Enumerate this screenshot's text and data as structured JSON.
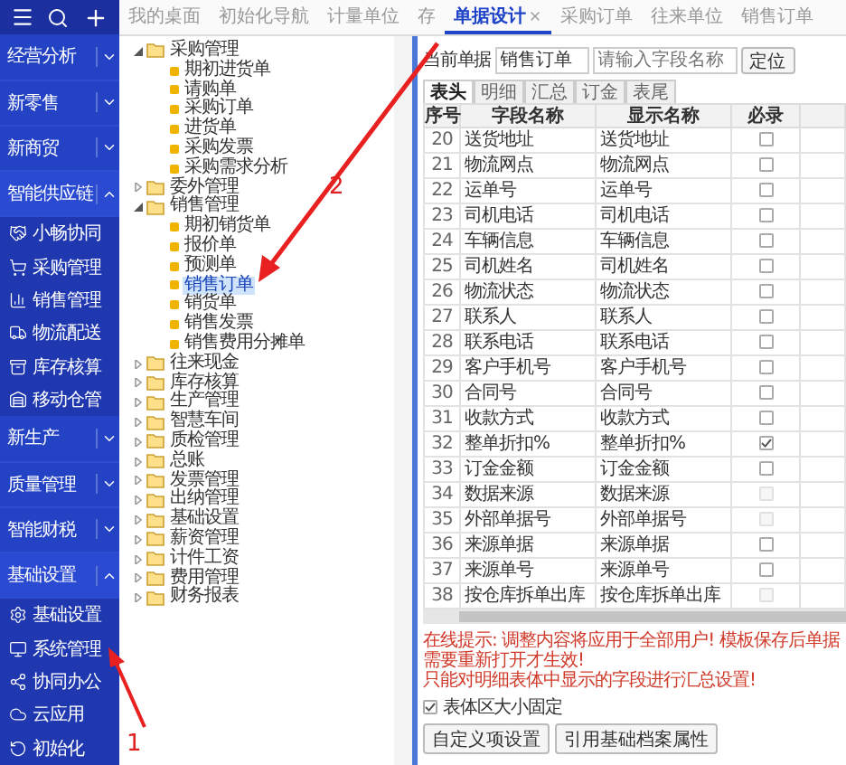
{
  "sidebar": {
    "groups": [
      {
        "label": "经营分析",
        "expanded": false
      },
      {
        "label": "新零售",
        "expanded": false
      },
      {
        "label": "新商贸",
        "expanded": false
      },
      {
        "label": "智能供应链",
        "expanded": true,
        "children": [
          {
            "label": "小畅协同"
          },
          {
            "label": "采购管理"
          },
          {
            "label": "销售管理"
          },
          {
            "label": "物流配送"
          },
          {
            "label": "库存核算"
          },
          {
            "label": "移动仓管"
          }
        ]
      },
      {
        "label": "新生产",
        "expanded": false
      },
      {
        "label": "质量管理",
        "expanded": false
      },
      {
        "label": "智能财税",
        "expanded": false
      },
      {
        "label": "基础设置",
        "expanded": true,
        "children": [
          {
            "label": "基础设置"
          },
          {
            "label": "系统管理"
          },
          {
            "label": "协同办公"
          },
          {
            "label": "云应用"
          },
          {
            "label": "初始化"
          }
        ]
      }
    ]
  },
  "tabs": [
    {
      "label": "我的桌面",
      "selected": false,
      "closable": false
    },
    {
      "label": "初始化导航",
      "selected": false,
      "closable": false
    },
    {
      "label": "计量单位",
      "selected": false,
      "closable": false
    },
    {
      "label": "存",
      "selected": false,
      "closable": false
    },
    {
      "label": "单据设计",
      "selected": true,
      "closable": true
    },
    {
      "label": "采购订单",
      "selected": false,
      "closable": false
    },
    {
      "label": "往来单位",
      "selected": false,
      "closable": false
    },
    {
      "label": "销售订单",
      "selected": false,
      "closable": false
    }
  ],
  "tree": [
    {
      "label": "采购管理",
      "expanded": true,
      "selected": false,
      "children": [
        {
          "label": "期初进货单",
          "selected": false
        },
        {
          "label": "请购单",
          "selected": false
        },
        {
          "label": "采购订单",
          "selected": false
        },
        {
          "label": "进货单",
          "selected": false
        },
        {
          "label": "采购发票",
          "selected": false
        },
        {
          "label": "采购需求分析",
          "selected": false
        }
      ]
    },
    {
      "label": "委外管理",
      "expanded": false,
      "selected": false
    },
    {
      "label": "销售管理",
      "expanded": true,
      "selected": false,
      "children": [
        {
          "label": "期初销货单",
          "selected": false
        },
        {
          "label": "报价单",
          "selected": false
        },
        {
          "label": "预测单",
          "selected": false
        },
        {
          "label": "销售订单",
          "selected": true
        },
        {
          "label": "销货单",
          "selected": false
        },
        {
          "label": "销售发票",
          "selected": false
        },
        {
          "label": "销售费用分摊单",
          "selected": false
        }
      ]
    },
    {
      "label": "往来现金",
      "expanded": false,
      "selected": false
    },
    {
      "label": "库存核算",
      "expanded": false,
      "selected": false
    },
    {
      "label": "生产管理",
      "expanded": false,
      "selected": false
    },
    {
      "label": "智慧车间",
      "expanded": false,
      "selected": false
    },
    {
      "label": "质检管理",
      "expanded": false,
      "selected": false
    },
    {
      "label": "总账",
      "expanded": false,
      "selected": false
    },
    {
      "label": "发票管理",
      "expanded": false,
      "selected": false
    },
    {
      "label": "出纳管理",
      "expanded": false,
      "selected": false
    },
    {
      "label": "基础设置",
      "expanded": false,
      "selected": false
    },
    {
      "label": "薪资管理",
      "expanded": false,
      "selected": false
    },
    {
      "label": "计件工资",
      "expanded": false,
      "selected": false
    },
    {
      "label": "费用管理",
      "expanded": false,
      "selected": false
    },
    {
      "label": "财务报表",
      "expanded": false,
      "selected": false
    }
  ],
  "designer": {
    "bill_label": "当前单据",
    "bill_value": "销售订单",
    "search": {
      "placeholder": "请输入字段名称"
    },
    "locate_button": "定位",
    "subtabs": [
      {
        "label": "表头",
        "selected": true
      },
      {
        "label": "明细",
        "selected": false
      },
      {
        "label": "汇总",
        "selected": false
      },
      {
        "label": "订金",
        "selected": false
      },
      {
        "label": "表尾",
        "selected": false
      }
    ],
    "table": {
      "columns": [
        "序号",
        "字段名称",
        "显示名称",
        "必录"
      ],
      "rows": [
        {
          "no": "20",
          "field": "送货地址",
          "display": "送货地址",
          "required": false,
          "disabled": false
        },
        {
          "no": "21",
          "field": "物流网点",
          "display": "物流网点",
          "required": false,
          "disabled": false
        },
        {
          "no": "22",
          "field": "运单号",
          "display": "运单号",
          "required": false,
          "disabled": false
        },
        {
          "no": "23",
          "field": "司机电话",
          "display": "司机电话",
          "required": false,
          "disabled": false
        },
        {
          "no": "24",
          "field": "车辆信息",
          "display": "车辆信息",
          "required": false,
          "disabled": false
        },
        {
          "no": "25",
          "field": "司机姓名",
          "display": "司机姓名",
          "required": false,
          "disabled": false
        },
        {
          "no": "26",
          "field": "物流状态",
          "display": "物流状态",
          "required": false,
          "disabled": false
        },
        {
          "no": "27",
          "field": "联系人",
          "display": "联系人",
          "required": false,
          "disabled": false
        },
        {
          "no": "28",
          "field": "联系电话",
          "display": "联系电话",
          "required": false,
          "disabled": false
        },
        {
          "no": "29",
          "field": "客户手机号",
          "display": "客户手机号",
          "required": false,
          "disabled": false
        },
        {
          "no": "30",
          "field": "合同号",
          "display": "合同号",
          "required": false,
          "disabled": false
        },
        {
          "no": "31",
          "field": "收款方式",
          "display": "收款方式",
          "required": false,
          "disabled": false
        },
        {
          "no": "32",
          "field": "整单折扣%",
          "display": "整单折扣%",
          "required": true,
          "disabled": false
        },
        {
          "no": "33",
          "field": "订金金额",
          "display": "订金金额",
          "required": false,
          "disabled": false
        },
        {
          "no": "34",
          "field": "数据来源",
          "display": "数据来源",
          "required": false,
          "disabled": true
        },
        {
          "no": "35",
          "field": "外部单据号",
          "display": "外部单据号",
          "required": false,
          "disabled": true
        },
        {
          "no": "36",
          "field": "来源单据",
          "display": "来源单据",
          "required": false,
          "disabled": false
        },
        {
          "no": "37",
          "field": "来源单号",
          "display": "来源单号",
          "required": false,
          "disabled": false
        },
        {
          "no": "38",
          "field": "按仓库拆单出库",
          "display": "按仓库拆单出库",
          "required": false,
          "disabled": true
        }
      ]
    },
    "hint_label": "在线提示:",
    "hint_lines": [
      "调整内容将应用于全部用户! 模板保存后单据需要重新打开才生效!",
      "只能对明细表体中显示的字段进行汇总设置!"
    ],
    "fixed_size": {
      "label": "表体区大小固定",
      "checked": true
    },
    "buttons": [
      "自定义项设置",
      "引用基础档案属性"
    ]
  },
  "annotations": [
    {
      "label": "1"
    },
    {
      "label": "2"
    }
  ]
}
